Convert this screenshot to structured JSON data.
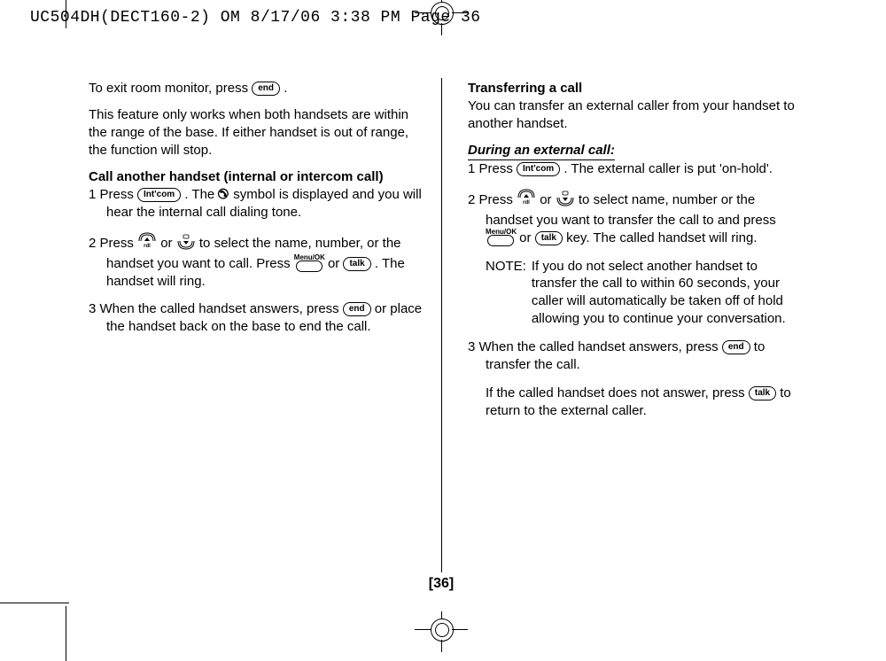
{
  "header": "UC504DH(DECT160-2) OM  8/17/06  3:38 PM  Page 36",
  "page_number": "[36]",
  "buttons": {
    "end": "end",
    "intcom": "Int'com",
    "talk": "talk",
    "menuok": "Menu/OK",
    "rdl_up": "rdl"
  },
  "left": {
    "exit_line_a": "To exit room monitor, press ",
    "exit_line_b": " .",
    "range_note": "This feature only works when both handsets are within the range of the base. If either handset is out of range, the function will stop.",
    "call_heading": "Call another handset (internal or intercom call)",
    "s1a": "1  Press ",
    "s1b": " . The ",
    "s1c": " symbol is displayed and you will hear the internal call dialing tone.",
    "s2a": "2  Press ",
    "s2_or": " or ",
    "s2b": " to select the name, number, or the handset you want to call. Press ",
    "s2c": " or ",
    "s2d": " . The handset will ring.",
    "s3a": "3  When the called handset answers, press ",
    "s3b": " or place the handset back on the base to end the call."
  },
  "right": {
    "transfer_heading": "Transferring a call",
    "transfer_intro": "You can transfer an external caller from your handset to another handset.",
    "during_heading": "During an external call:",
    "s1a": "1  Press ",
    "s1b": " . The external caller is put 'on-hold'.",
    "s2a": "2  Press ",
    "s2_or": " or ",
    "s2b": " to select name, number or the handset you want to transfer the call to and press ",
    "s2c": " or ",
    "s2d": " key. The called handset will ring.",
    "note_label": "NOTE:",
    "note_body": "If you do not select another handset to transfer the call to within 60 seconds, your caller will automatically be taken off of hold allowing you to continue your conversation.",
    "s3a": "3  When the called handset answers, press ",
    "s3b": " to transfer the call.",
    "noanswer_a": "If the called handset does not answer, press ",
    "noanswer_b": " to return to the external caller."
  }
}
